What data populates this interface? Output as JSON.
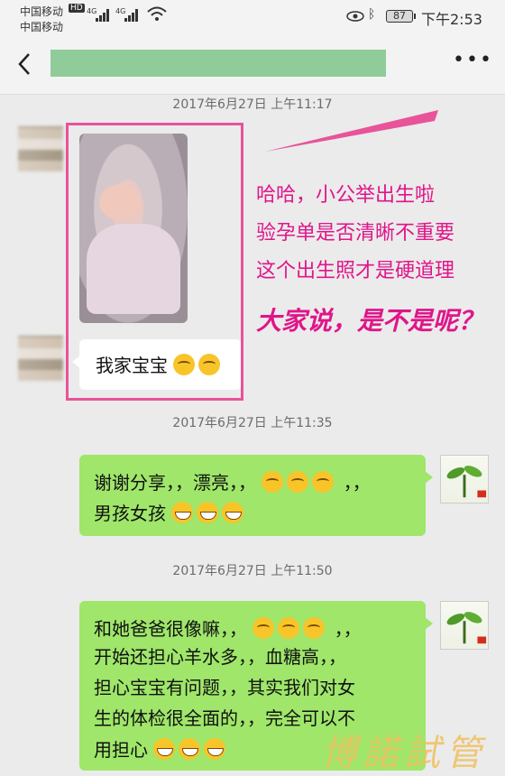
{
  "status": {
    "carrier1": "中国移动",
    "carrier1_badge": "HD",
    "carrier2": "中国移动",
    "net1": "4G",
    "net2": "4G",
    "battery": "87",
    "time": "下午2:53"
  },
  "chat": {
    "title": "",
    "timestamps": [
      "2017年6月27日 上午11:17",
      "2017年6月27日 上午11:35",
      "2017年6月27日 上午11:50"
    ],
    "messages": [
      {
        "side": "left",
        "type": "image"
      },
      {
        "side": "left",
        "type": "text",
        "text": "我家宝宝",
        "emoji": [
          "think",
          "think"
        ]
      },
      {
        "side": "right",
        "type": "text",
        "lines": [
          "谢谢分享，，漂亮，，",
          "，，",
          "男孩女孩"
        ],
        "emoji_line1": [
          "think",
          "think",
          "think"
        ],
        "emoji_line2": [
          "grin",
          "grin",
          "grin"
        ]
      },
      {
        "side": "right",
        "type": "text",
        "lines": [
          "和她爸爸很像嘛，，",
          "，，",
          "开始还担心羊水多，，血糖高，，",
          "担心宝宝有问题，，其实我们对女",
          "生的体检很全面的，，完全可以不",
          "用担心"
        ],
        "emoji_line1": [
          "think",
          "think",
          "think"
        ],
        "emoji_last": [
          "grin",
          "grin",
          "grin"
        ]
      }
    ]
  },
  "annotation": {
    "line1": "哈哈，小公举出生啦",
    "line2": "验孕单是否清晰不重要",
    "line3": "这个出生照才是硬道理",
    "line4": "大家说，是不是呢？"
  },
  "watermark": "博諾試管",
  "colors": {
    "highlight": "#e8539a",
    "annotation": "#e0158a",
    "bubble_green": "#9fe66a",
    "title_mask": "#8fcc9a"
  }
}
